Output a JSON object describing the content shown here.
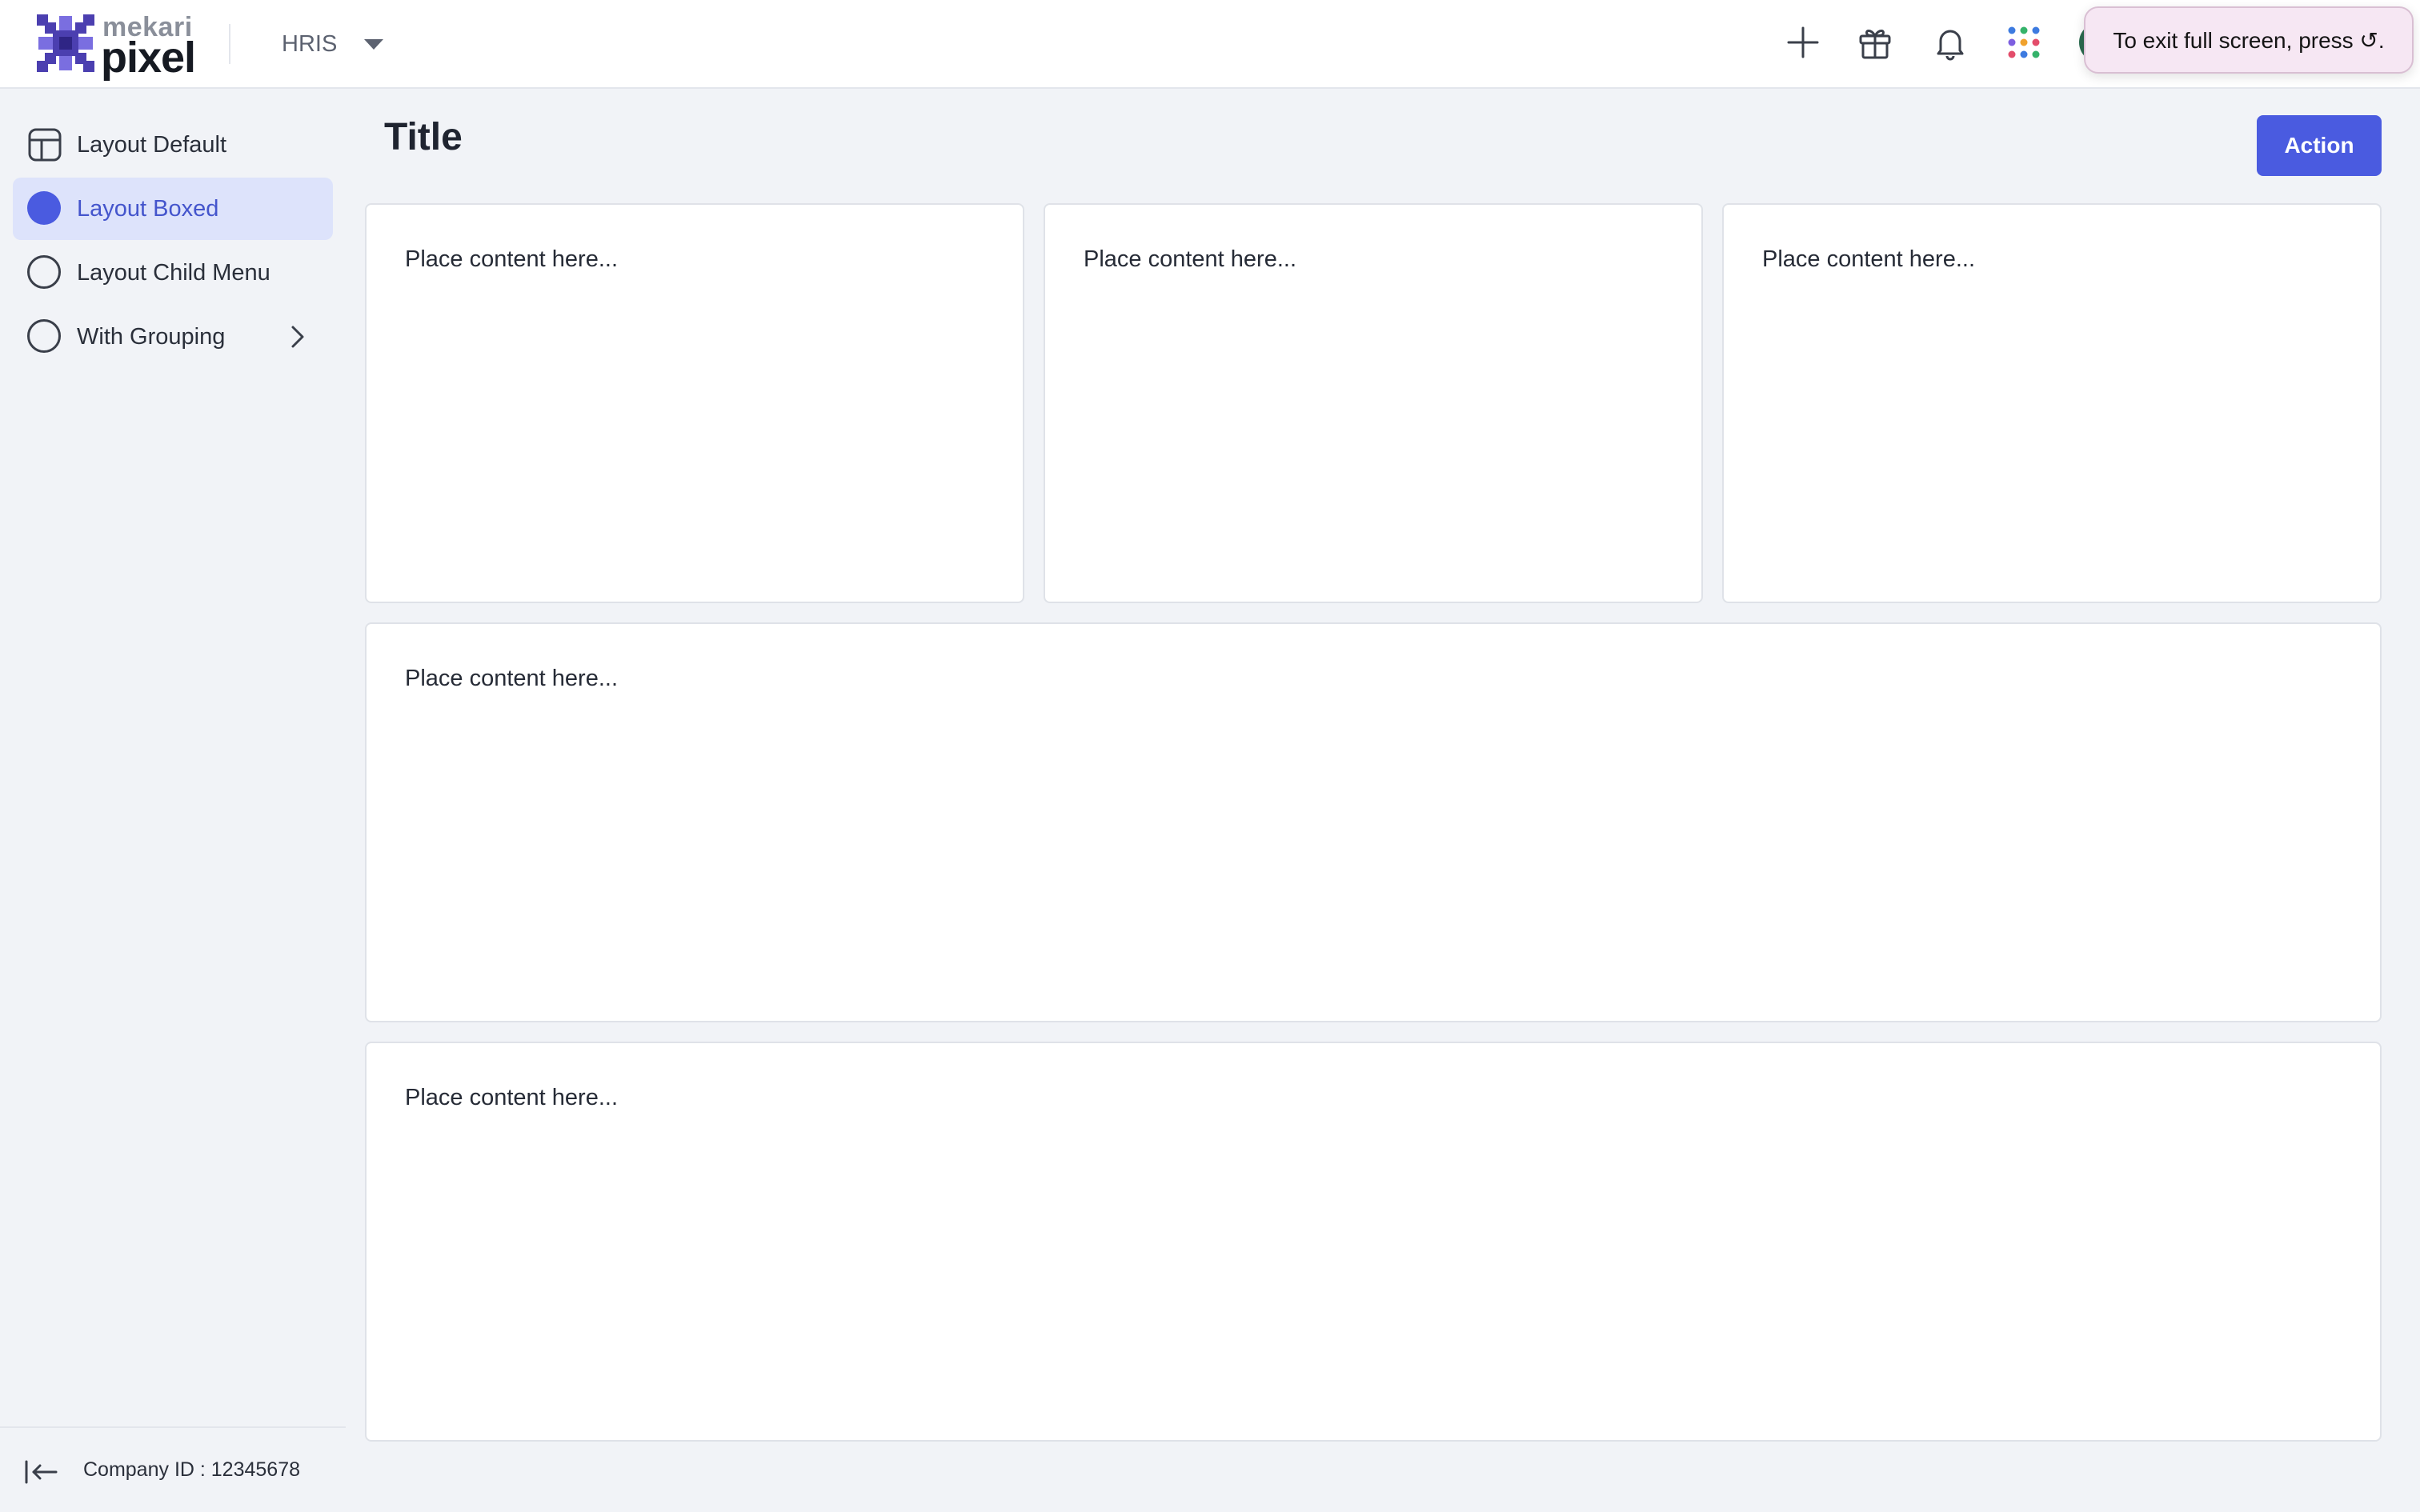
{
  "header": {
    "logo_top": "mekari",
    "logo_main": "pixel",
    "product": "HRIS",
    "toast": "To exit full screen, press ↺."
  },
  "sidebar": {
    "items": [
      {
        "label": "Layout Default"
      },
      {
        "label": "Layout Boxed"
      },
      {
        "label": "Layout Child Menu"
      },
      {
        "label": "With Grouping"
      }
    ],
    "company_id": "Company ID : 12345678"
  },
  "main": {
    "title": "Title",
    "action_label": "Action",
    "cards": [
      {
        "text": "Place content here..."
      },
      {
        "text": "Place content here..."
      },
      {
        "text": "Place content here..."
      },
      {
        "text": "Place content here..."
      },
      {
        "text": "Place content here..."
      }
    ]
  },
  "colors": {
    "accent": "#4a5be0",
    "active_bg": "#dde3fb",
    "page_bg": "#f1f3f7"
  }
}
